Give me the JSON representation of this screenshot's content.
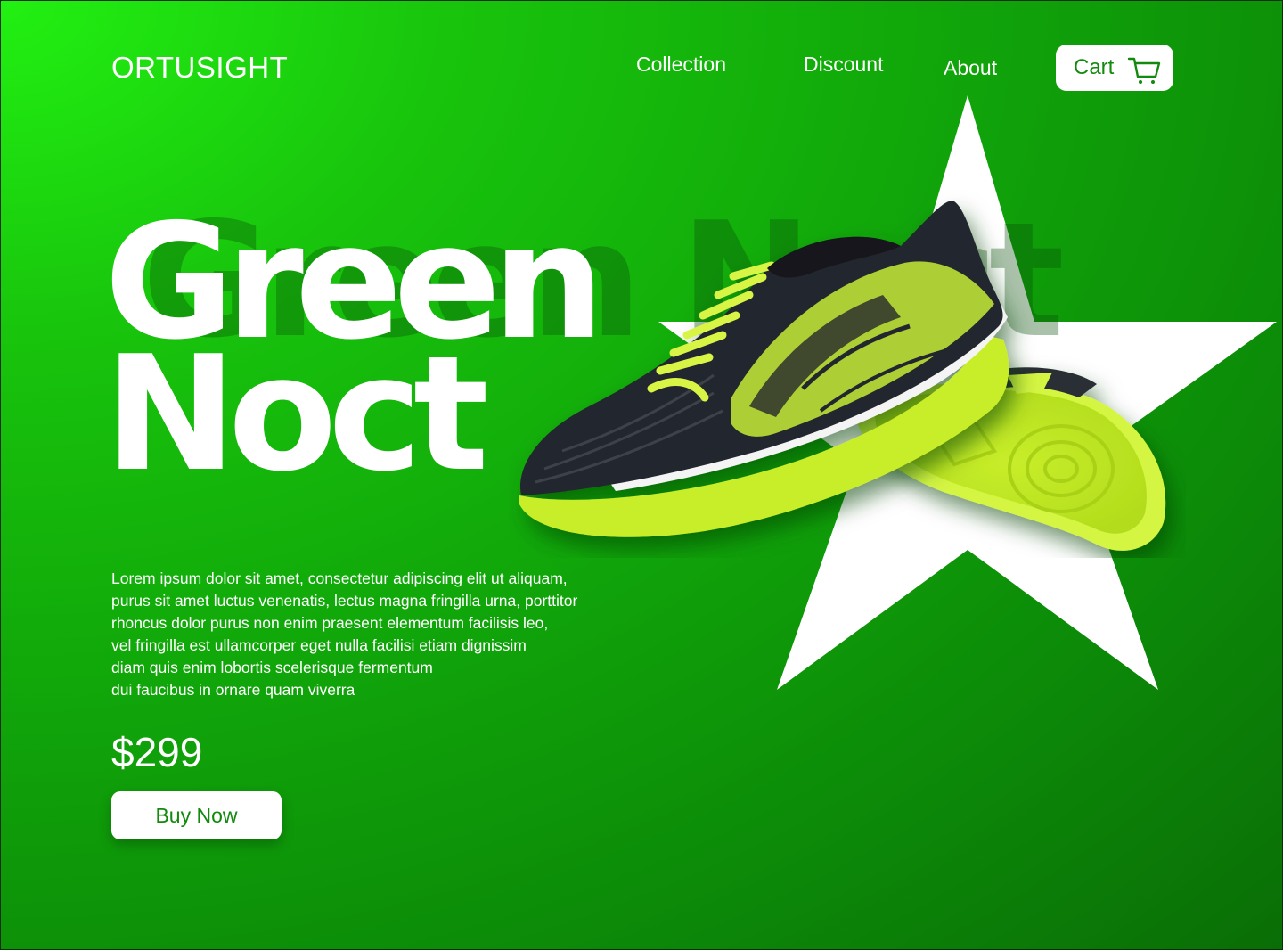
{
  "header": {
    "brand": "ORTUSIGHT",
    "nav": [
      {
        "label": "Collection"
      },
      {
        "label": "Discount"
      },
      {
        "label": "About"
      }
    ],
    "cart": {
      "label": "Cart",
      "icon": "shopping-cart-icon"
    }
  },
  "hero": {
    "title_line1": "Green",
    "title_line2": "Noct",
    "description_lines": [
      "Lorem ipsum dolor sit amet, consectetur adipiscing elit ut aliquam,",
      "purus sit amet luctus venenatis, lectus magna fringilla urna, porttitor",
      "rhoncus dolor purus non enim praesent elementum facilisis leo,",
      "vel fringilla est ullamcorper eget nulla facilisi etiam dignissim",
      "diam quis enim lobortis scelerisque fermentum",
      "dui faucibus in ornare quam viverra"
    ],
    "price": "$299",
    "buy_label": "Buy Now",
    "product_image": "black-and-neon-green-indoor-soccer-shoe",
    "decoration": "white-star"
  },
  "colors": {
    "accent_green": "#128a0e",
    "neon": "#d4f542",
    "background_light": "#22f012",
    "background_dark": "#0a6e06"
  }
}
